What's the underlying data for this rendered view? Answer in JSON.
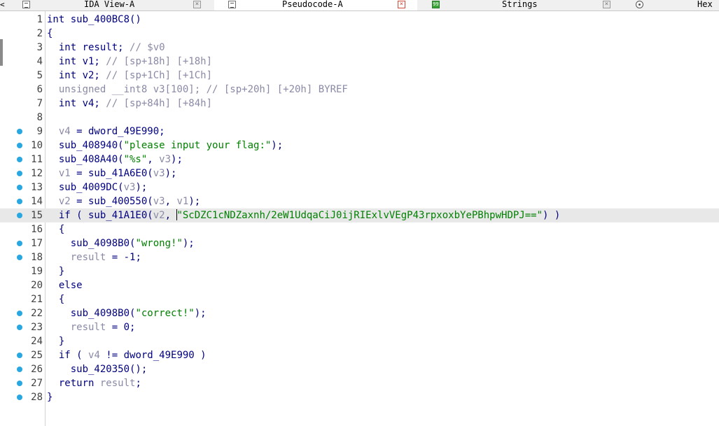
{
  "tabs": [
    {
      "id": "ida-view",
      "label": "IDA View-A",
      "icon": "listing-icon",
      "close": "×",
      "active": false
    },
    {
      "id": "pseudocode",
      "label": "Pseudocode-A",
      "icon": "listing-icon",
      "close": "×",
      "active": true
    },
    {
      "id": "strings",
      "label": "Strings",
      "icon": "strings-icon",
      "icon_text": "99",
      "close": "×",
      "active": false
    },
    {
      "id": "hex",
      "label": "Hex",
      "icon": "hex-icon",
      "active": false
    }
  ],
  "scroll_left_glyph": "<",
  "colors": {
    "keyword": "#000080",
    "variable": "#8a8aa6",
    "comment": "#8a8aa6",
    "string": "#008000",
    "breakpoint_dot": "#29a7e1",
    "current_line": "#e8e8e8"
  },
  "code_lines": [
    {
      "n": "1",
      "dot": false,
      "tokens": [
        [
          "k",
          "int sub_400BC8()"
        ]
      ]
    },
    {
      "n": "2",
      "dot": false,
      "tokens": [
        [
          "p",
          "{"
        ]
      ]
    },
    {
      "n": "3",
      "dot": false,
      "tokens": [
        [
          "k",
          "  int result; "
        ],
        [
          "c",
          "// $v0"
        ]
      ]
    },
    {
      "n": "4",
      "dot": false,
      "tokens": [
        [
          "k",
          "  int v1; "
        ],
        [
          "c",
          "// [sp+18h] [+18h]"
        ]
      ]
    },
    {
      "n": "5",
      "dot": false,
      "tokens": [
        [
          "k",
          "  int v2; "
        ],
        [
          "c",
          "// [sp+1Ch] [+1Ch]"
        ]
      ]
    },
    {
      "n": "6",
      "dot": false,
      "tokens": [
        [
          "c",
          "  unsigned __int8 v3[100]; // [sp+20h] [+20h] BYREF"
        ]
      ]
    },
    {
      "n": "7",
      "dot": false,
      "tokens": [
        [
          "k",
          "  int v4; "
        ],
        [
          "c",
          "// [sp+84h] [+84h]"
        ]
      ]
    },
    {
      "n": "8",
      "dot": false,
      "tokens": []
    },
    {
      "n": "9",
      "dot": true,
      "tokens": [
        [
          "v",
          "  v4"
        ],
        [
          "k",
          " = dword_49E990;"
        ]
      ]
    },
    {
      "n": "10",
      "dot": true,
      "tokens": [
        [
          "k",
          "  sub_408940("
        ],
        [
          "s",
          "\"please input your flag:\""
        ],
        [
          "k",
          ");"
        ]
      ]
    },
    {
      "n": "11",
      "dot": true,
      "tokens": [
        [
          "k",
          "  sub_408A40("
        ],
        [
          "s",
          "\"%s\""
        ],
        [
          "k",
          ", "
        ],
        [
          "v",
          "v3"
        ],
        [
          "k",
          ");"
        ]
      ]
    },
    {
      "n": "12",
      "dot": true,
      "tokens": [
        [
          "v",
          "  v1"
        ],
        [
          "k",
          " = sub_41A6E0("
        ],
        [
          "v",
          "v3"
        ],
        [
          "k",
          ");"
        ]
      ]
    },
    {
      "n": "13",
      "dot": true,
      "tokens": [
        [
          "k",
          "  sub_4009DC("
        ],
        [
          "v",
          "v3"
        ],
        [
          "k",
          ");"
        ]
      ]
    },
    {
      "n": "14",
      "dot": true,
      "tokens": [
        [
          "v",
          "  v2"
        ],
        [
          "k",
          " = sub_400550("
        ],
        [
          "v",
          "v3"
        ],
        [
          "k",
          ", "
        ],
        [
          "v",
          "v1"
        ],
        [
          "k",
          ");"
        ]
      ]
    },
    {
      "n": "15",
      "dot": true,
      "current": true,
      "tokens": [
        [
          "k",
          "  if ( sub_41A1E0("
        ],
        [
          "v",
          "v2"
        ],
        [
          "k",
          ", "
        ],
        [
          "cursor",
          ""
        ],
        [
          "s",
          "\"ScDZC1cNDZaxnh/2eW1UdqaCiJ0ijRIExlvVEgP43rpxoxbYePBhpwHDPJ==\""
        ],
        [
          "k",
          ") )"
        ]
      ]
    },
    {
      "n": "16",
      "dot": false,
      "tokens": [
        [
          "p",
          "  {"
        ]
      ]
    },
    {
      "n": "17",
      "dot": true,
      "tokens": [
        [
          "k",
          "    sub_4098B0("
        ],
        [
          "s",
          "\"wrong!\""
        ],
        [
          "k",
          ");"
        ]
      ]
    },
    {
      "n": "18",
      "dot": true,
      "tokens": [
        [
          "v",
          "    result"
        ],
        [
          "k",
          " = -1;"
        ]
      ]
    },
    {
      "n": "19",
      "dot": false,
      "tokens": [
        [
          "p",
          "  }"
        ]
      ]
    },
    {
      "n": "20",
      "dot": false,
      "tokens": [
        [
          "k",
          "  else"
        ]
      ]
    },
    {
      "n": "21",
      "dot": false,
      "tokens": [
        [
          "p",
          "  {"
        ]
      ]
    },
    {
      "n": "22",
      "dot": true,
      "tokens": [
        [
          "k",
          "    sub_4098B0("
        ],
        [
          "s",
          "\"correct!\""
        ],
        [
          "k",
          ");"
        ]
      ]
    },
    {
      "n": "23",
      "dot": true,
      "tokens": [
        [
          "v",
          "    result"
        ],
        [
          "k",
          " = 0;"
        ]
      ]
    },
    {
      "n": "24",
      "dot": false,
      "tokens": [
        [
          "p",
          "  }"
        ]
      ]
    },
    {
      "n": "25",
      "dot": true,
      "tokens": [
        [
          "k",
          "  if ( "
        ],
        [
          "v",
          "v4"
        ],
        [
          "k",
          " != dword_49E990 )"
        ]
      ]
    },
    {
      "n": "26",
      "dot": true,
      "tokens": [
        [
          "k",
          "    sub_420350();"
        ]
      ]
    },
    {
      "n": "27",
      "dot": true,
      "tokens": [
        [
          "k",
          "  return "
        ],
        [
          "v",
          "result"
        ],
        [
          "k",
          ";"
        ]
      ]
    },
    {
      "n": "28",
      "dot": true,
      "tokens": [
        [
          "p",
          "}"
        ]
      ]
    }
  ]
}
